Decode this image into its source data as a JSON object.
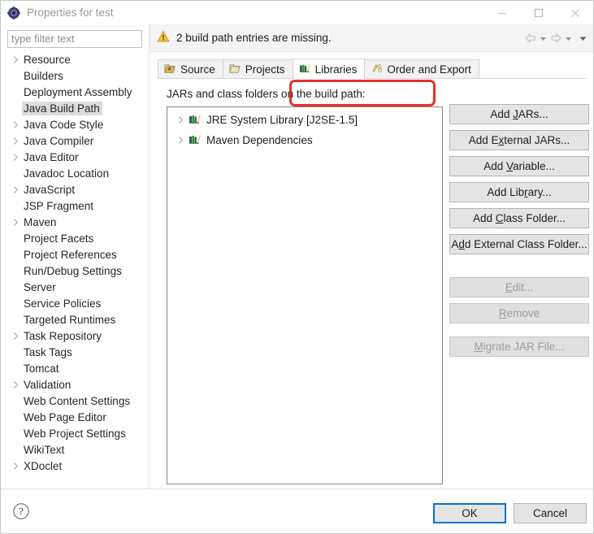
{
  "window": {
    "title": "Properties for test",
    "icon": "properties-gear-icon",
    "controls": {
      "minimize": "minimize-icon",
      "maximize": "maximize-icon",
      "close": "close-icon"
    }
  },
  "filter": {
    "placeholder": "type filter text",
    "value": ""
  },
  "sidebar": {
    "items": [
      {
        "label": "Resource",
        "expandable": true,
        "selected": false
      },
      {
        "label": "Builders",
        "expandable": false,
        "selected": false
      },
      {
        "label": "Deployment Assembly",
        "expandable": false,
        "selected": false
      },
      {
        "label": "Java Build Path",
        "expandable": false,
        "selected": true
      },
      {
        "label": "Java Code Style",
        "expandable": true,
        "selected": false
      },
      {
        "label": "Java Compiler",
        "expandable": true,
        "selected": false
      },
      {
        "label": "Java Editor",
        "expandable": true,
        "selected": false
      },
      {
        "label": "Javadoc Location",
        "expandable": false,
        "selected": false
      },
      {
        "label": "JavaScript",
        "expandable": true,
        "selected": false
      },
      {
        "label": "JSP Fragment",
        "expandable": false,
        "selected": false
      },
      {
        "label": "Maven",
        "expandable": true,
        "selected": false
      },
      {
        "label": "Project Facets",
        "expandable": false,
        "selected": false
      },
      {
        "label": "Project References",
        "expandable": false,
        "selected": false
      },
      {
        "label": "Run/Debug Settings",
        "expandable": false,
        "selected": false
      },
      {
        "label": "Server",
        "expandable": false,
        "selected": false
      },
      {
        "label": "Service Policies",
        "expandable": false,
        "selected": false
      },
      {
        "label": "Targeted Runtimes",
        "expandable": false,
        "selected": false
      },
      {
        "label": "Task Repository",
        "expandable": true,
        "selected": false
      },
      {
        "label": "Task Tags",
        "expandable": false,
        "selected": false
      },
      {
        "label": "Tomcat",
        "expandable": false,
        "selected": false
      },
      {
        "label": "Validation",
        "expandable": true,
        "selected": false
      },
      {
        "label": "Web Content Settings",
        "expandable": false,
        "selected": false
      },
      {
        "label": "Web Page Editor",
        "expandable": false,
        "selected": false
      },
      {
        "label": "Web Project Settings",
        "expandable": false,
        "selected": false
      },
      {
        "label": "WikiText",
        "expandable": false,
        "selected": false
      },
      {
        "label": "XDoclet",
        "expandable": true,
        "selected": false
      }
    ]
  },
  "message_bar": {
    "icon": "warning-icon",
    "text": "2 build path entries are missing.",
    "nav": {
      "back": "back-arrow-icon",
      "back_menu": "chevron-down-icon",
      "forward": "forward-arrow-icon",
      "forward_menu": "chevron-down-icon",
      "overflow_menu": "chevron-down-icon"
    }
  },
  "tabs": [
    {
      "label": "Source",
      "icon": "source-folder-icon",
      "active": false
    },
    {
      "label": "Projects",
      "icon": "project-folder-icon",
      "active": false
    },
    {
      "label": "Libraries",
      "icon": "library-books-icon",
      "active": true
    },
    {
      "label": "Order and Export",
      "icon": "order-export-icon",
      "active": false
    }
  ],
  "libraries_tab": {
    "list_label": "JARs and class folders on the build path:",
    "entries": [
      {
        "label": "JRE System Library [J2SE-1.5]",
        "icon": "library-books-icon",
        "expandable": true
      },
      {
        "label": "Maven Dependencies",
        "icon": "library-books-icon",
        "expandable": true
      }
    ],
    "buttons": [
      {
        "label": "Add JARs...",
        "mnemonic": "J",
        "enabled": true,
        "highlighted": false
      },
      {
        "label": "Add External JARs...",
        "mnemonic": "x",
        "enabled": true,
        "highlighted": false
      },
      {
        "label": "Add Variable...",
        "mnemonic": "V",
        "enabled": true,
        "highlighted": false
      },
      {
        "label": "Add Library...",
        "mnemonic": "r",
        "enabled": true,
        "highlighted": true
      },
      {
        "label": "Add Class Folder...",
        "mnemonic": "C",
        "enabled": true,
        "highlighted": false
      },
      {
        "label": "Add External Class Folder...",
        "mnemonic": "d",
        "enabled": true,
        "highlighted": false
      },
      {
        "label": "Edit...",
        "mnemonic": "E",
        "enabled": false,
        "highlighted": false
      },
      {
        "label": "Remove",
        "mnemonic": "R",
        "enabled": false,
        "highlighted": false
      },
      {
        "label": "Migrate JAR File...",
        "mnemonic": "M",
        "enabled": false,
        "highlighted": false
      }
    ]
  },
  "footer": {
    "help": "help-icon",
    "ok_label": "OK",
    "cancel_label": "Cancel"
  },
  "colors": {
    "annotation_red": "#e8302a",
    "default_button_focus": "#0a73c8",
    "selection_gray": "#dcdcdc",
    "warning_amber": "#f0b429"
  }
}
